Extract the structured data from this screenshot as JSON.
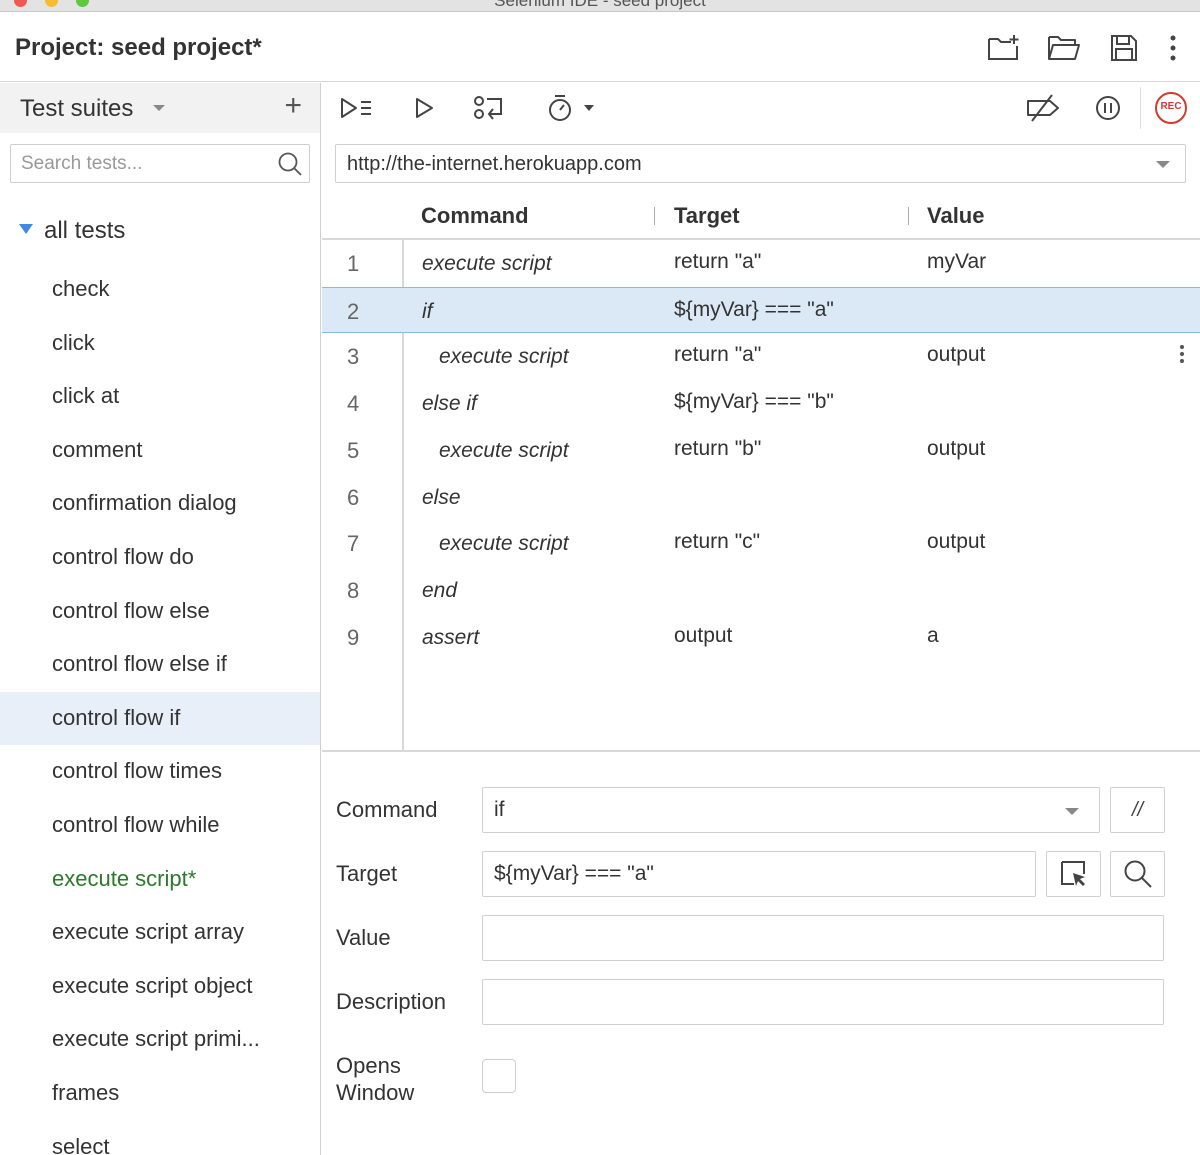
{
  "window": {
    "title": "Selenium IDE - seed project",
    "traffic_lights": [
      "#ee5a52",
      "#f5bd2f",
      "#5fc83f"
    ]
  },
  "header": {
    "project_title": "Project:  seed project*",
    "icons": [
      "new-project-icon",
      "open-folder-icon",
      "save-icon",
      "more-vertical-icon"
    ]
  },
  "sidebar": {
    "dropdown_label": "Test suites",
    "add_label": "+",
    "search_placeholder": "Search tests...",
    "root_label": "all tests",
    "tests": [
      {
        "label": "check"
      },
      {
        "label": "click"
      },
      {
        "label": "click at"
      },
      {
        "label": "comment"
      },
      {
        "label": "confirmation dialog"
      },
      {
        "label": "control flow do"
      },
      {
        "label": "control flow else"
      },
      {
        "label": "control flow else if"
      },
      {
        "label": "control flow if",
        "selected": true
      },
      {
        "label": "control flow times"
      },
      {
        "label": "control flow while"
      },
      {
        "label": "execute script*",
        "changed": true
      },
      {
        "label": "execute script array"
      },
      {
        "label": "execute script object"
      },
      {
        "label": "execute script primi..."
      },
      {
        "label": "frames"
      },
      {
        "label": "select"
      }
    ]
  },
  "toolbar": {
    "icons": [
      "run-all-tests-icon",
      "run-current-test-icon",
      "step-over-icon",
      "test-speed-icon",
      "disable-breakpoints-icon",
      "pause-on-exceptions-icon",
      "record-icon"
    ],
    "record_label": "REC"
  },
  "url": {
    "value": "http://the-internet.herokuapp.com"
  },
  "grid": {
    "headers": {
      "command": "Command",
      "target": "Target",
      "value": "Value"
    },
    "rows": [
      {
        "num": "1",
        "command": "execute script",
        "target": "return \"a\"",
        "value": "myVar",
        "indent": 0
      },
      {
        "num": "2",
        "command": "if",
        "target": "${myVar} === \"a\"",
        "value": "",
        "indent": 0,
        "selected": true
      },
      {
        "num": "3",
        "command": "execute script",
        "target": "return \"a\"",
        "value": "output",
        "indent": 1
      },
      {
        "num": "4",
        "command": "else if",
        "target": "${myVar} === \"b\"",
        "value": "",
        "indent": 0
      },
      {
        "num": "5",
        "command": "execute script",
        "target": "return \"b\"",
        "value": "output",
        "indent": 1
      },
      {
        "num": "6",
        "command": "else",
        "target": "",
        "value": "",
        "indent": 0
      },
      {
        "num": "7",
        "command": "execute script",
        "target": "return \"c\"",
        "value": "output",
        "indent": 1
      },
      {
        "num": "8",
        "command": "end",
        "target": "",
        "value": "",
        "indent": 0
      },
      {
        "num": "9",
        "command": "assert",
        "target": "output",
        "value": "a",
        "indent": 0
      }
    ]
  },
  "editor": {
    "command_label": "Command",
    "command_value": "if",
    "comment_button": "//",
    "target_label": "Target",
    "target_value": "${myVar} === \"a\"",
    "value_label": "Value",
    "value_value": "",
    "description_label": "Description",
    "description_value": "",
    "opens_window_label_1": "Opens",
    "opens_window_label_2": "Window",
    "opens_window_checked": false
  },
  "colors": {
    "accent": "#3d8ae0",
    "selected_row": "#dbe9f7",
    "selected_test": "#e9eff8",
    "changed_text": "#2b7a2b",
    "record": "#d33a2c"
  }
}
